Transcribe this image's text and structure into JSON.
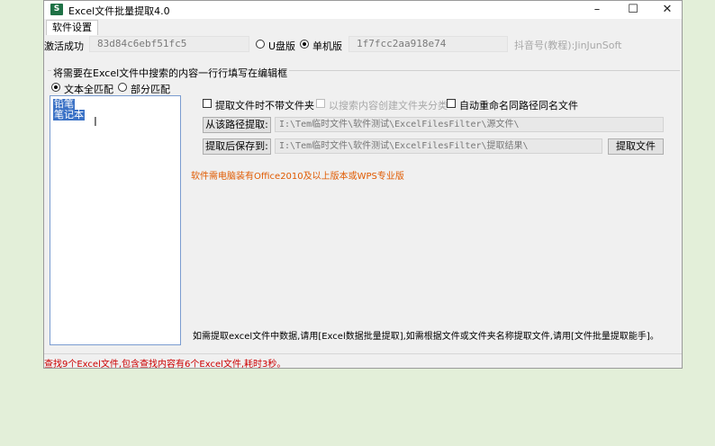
{
  "window": {
    "app_icon": "S",
    "title": "Excel文件批量提取4.0",
    "controls": {
      "minimize": "–",
      "maximize": "☐",
      "close": "✕"
    }
  },
  "menu": {
    "tab_label": "软件设置"
  },
  "activation": {
    "label": "激活成功",
    "code": "83d84c6ebf51fc5",
    "radio_usb": "U盘版",
    "radio_standalone": "单机版",
    "machine_code": "1f7fcc2aa918e74",
    "author": "抖音号(教程):JinJunSoft"
  },
  "group": {
    "title": "将需要在Excel文件中搜索的内容一行行填写在编辑框",
    "match_full": "文本全匹配",
    "match_partial": "部分匹配",
    "selected_mode": "full"
  },
  "search_list": {
    "items": [
      "铅笔",
      "笔记本"
    ]
  },
  "options": {
    "no_folder": "提取文件时不带文件夹",
    "by_content_folder": "以搜索内容创建文件夹分类",
    "auto_rename": "自动重命名同路径同名文件"
  },
  "paths": {
    "source_button": "从该路径提取:",
    "source_value": "I:\\Tem临时文件\\软件测试\\ExcelFilesFilter\\源文件\\",
    "target_button": "提取后保存到:",
    "target_value": "I:\\Tem临时文件\\软件测试\\ExcelFilesFilter\\提取结果\\",
    "extract_button": "提取文件"
  },
  "notice": "软件需电脑装有Office2010及以上版本或WPS专业版",
  "hint": "如需提取excel文件中数据,请用[Excel数据批量提取],如需根据文件或文件夹名称提取文件,请用[文件批量提取能手]。",
  "status": "查找9个Excel文件,包含查找内容有6个Excel文件,耗时3秒。",
  "colors": {
    "background": "#e3efd9",
    "status_red": "#cc0000",
    "notice_orange": "#e05a00",
    "selection": "#3b72c6"
  }
}
